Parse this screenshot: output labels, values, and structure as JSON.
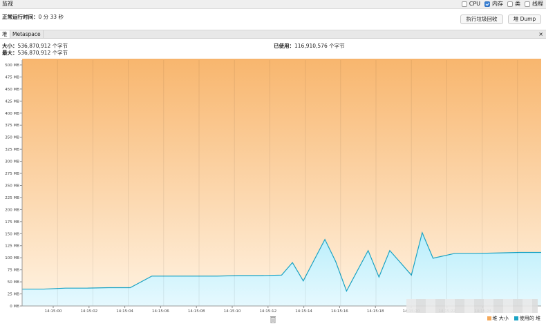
{
  "header": {
    "title": "监视",
    "checkboxes": [
      {
        "label": "CPU",
        "checked": false
      },
      {
        "label": "内存",
        "checked": true
      },
      {
        "label": "类",
        "checked": false
      },
      {
        "label": "线程",
        "checked": false
      }
    ]
  },
  "uptime": {
    "label": "正常运行时间：",
    "value": "0 分 33 秒"
  },
  "buttons": {
    "gc": "执行垃圾回收",
    "dump": "堆 Dump"
  },
  "tabs": [
    {
      "label": "堆"
    },
    {
      "label": "Metaspace"
    }
  ],
  "tab_close": "×",
  "info": {
    "size_label": "大小：",
    "size_value": "536,870,912 个字节",
    "max_label": "最大：",
    "max_value": "536,870,912 个字节",
    "used_label": "已使用：",
    "used_value": "116,910,576 个字节"
  },
  "colors": {
    "heap_size": "#f5a95a",
    "heap_used": "#1aa3c4"
  },
  "chart_data": {
    "type": "area",
    "y_ticks": [
      "0 MB",
      "25 MB",
      "50 MB",
      "75 MB",
      "100 MB",
      "125 MB",
      "150 MB",
      "175 MB",
      "200 MB",
      "225 MB",
      "250 MB",
      "275 MB",
      "300 MB",
      "325 MB",
      "350 MB",
      "375 MB",
      "400 MB",
      "425 MB",
      "450 MB",
      "475 MB",
      "500 MB"
    ],
    "ylim": [
      0,
      510
    ],
    "x_ticks": [
      "14:15:00",
      "14:15:02",
      "14:15:04",
      "14:15:06",
      "14:15:08",
      "14:15:10",
      "14:15:12",
      "14:15:14",
      "14:15:16",
      "14:15:18",
      "14:15:20",
      "14:15:22",
      "14:15:24"
    ],
    "series": [
      {
        "name": "堆 大小",
        "color": "#f5a95a",
        "x": [
          0,
          24
        ],
        "values": [
          512,
          512
        ]
      },
      {
        "name": "使用的 堆",
        "color": "#1aa3c4",
        "x": [
          0,
          1,
          2,
          3,
          4,
          5,
          6,
          7,
          8,
          9,
          10,
          11,
          12,
          12.5,
          13,
          14,
          14.5,
          15,
          16,
          16.5,
          17,
          18,
          18.5,
          19,
          20,
          21,
          22,
          23,
          24
        ],
        "values": [
          35,
          35,
          37,
          37,
          38,
          38,
          62,
          62,
          62,
          62,
          63,
          63,
          64,
          90,
          52,
          138,
          92,
          31,
          115,
          60,
          115,
          64,
          152,
          99,
          109,
          109,
          110,
          111,
          111
        ]
      }
    ],
    "legend": "bottom-right"
  }
}
